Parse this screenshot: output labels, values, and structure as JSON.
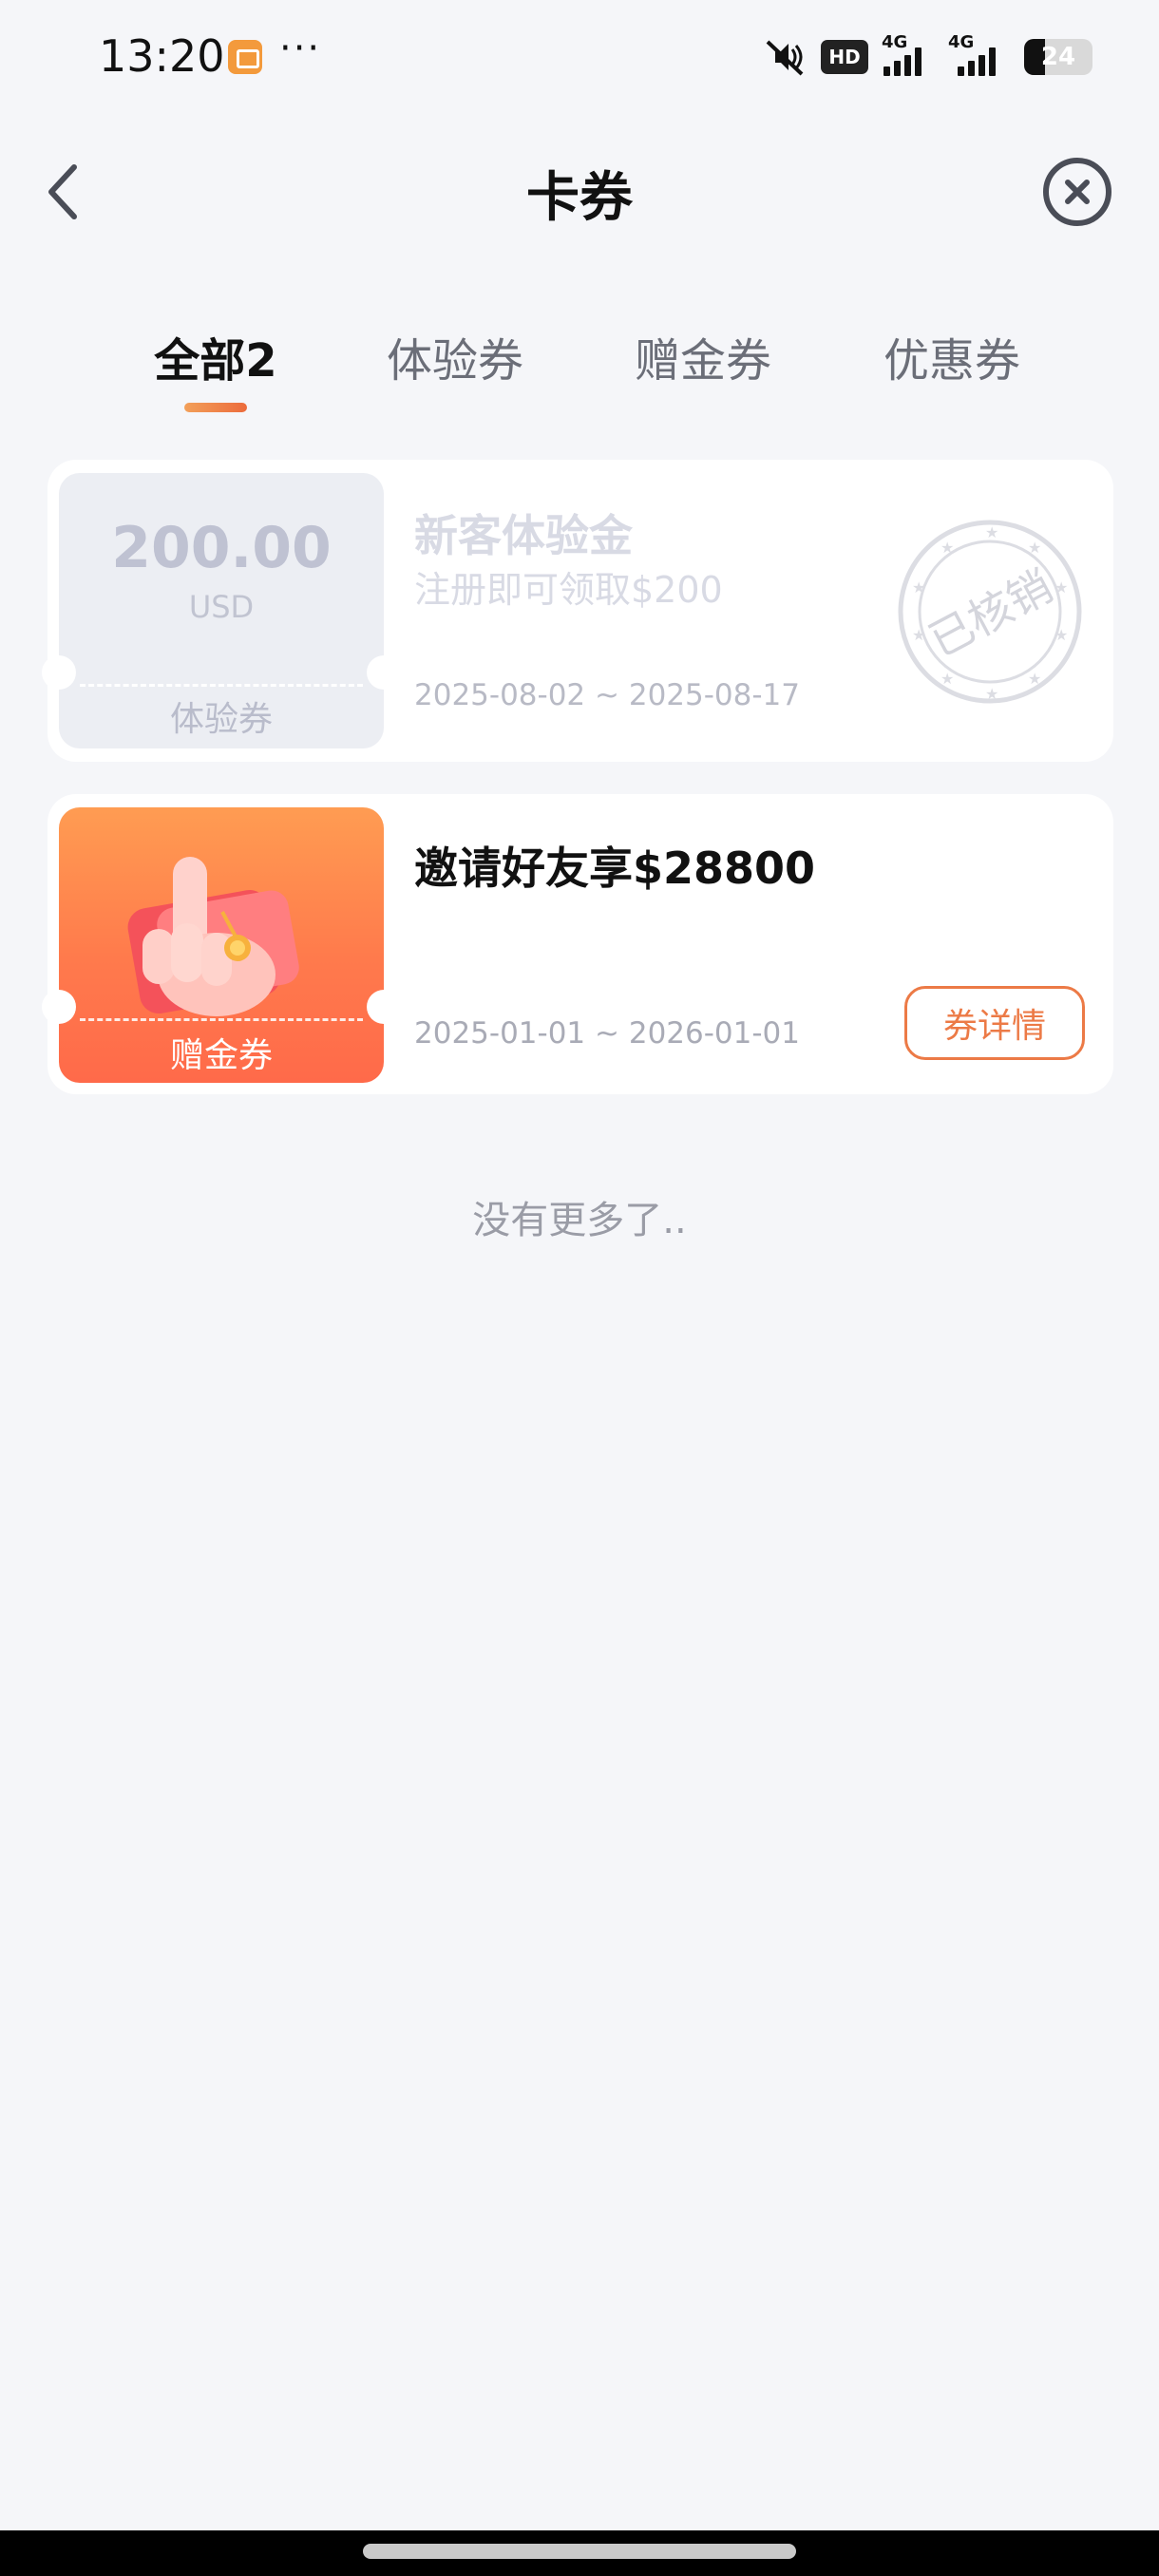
{
  "status_bar": {
    "time": "13:20",
    "dots": "···",
    "hd": "HD",
    "net1": "4G",
    "net2": "4G",
    "battery": "24"
  },
  "header": {
    "title": "卡券"
  },
  "tabs": [
    {
      "label": "全部2",
      "active": true
    },
    {
      "label": "体验券",
      "active": false
    },
    {
      "label": "赠金券",
      "active": false
    },
    {
      "label": "优惠券",
      "active": false
    }
  ],
  "cards": [
    {
      "amount": "200.00",
      "unit": "USD",
      "type": "体验券",
      "title": "新客体验金",
      "subtitle": "注册即可领取$200",
      "date": "2025-08-02 ~ 2025-08-17",
      "stamp": "已核销"
    },
    {
      "type": "赠金券",
      "title": "邀请好友享$28800",
      "date": "2025-01-01 ~ 2026-01-01",
      "button": "券详情"
    }
  ],
  "footer": {
    "no_more": "没有更多了.."
  },
  "colors": {
    "accent": "#ec7a46",
    "background": "#f5f6f9"
  }
}
